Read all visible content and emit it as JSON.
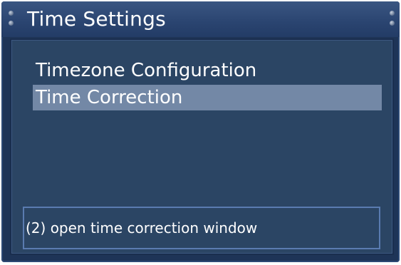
{
  "window": {
    "title": "Time Settings"
  },
  "menu": {
    "items": [
      {
        "label": "Timezone Configuration",
        "selected": false
      },
      {
        "label": "Time Correction",
        "selected": true
      }
    ]
  },
  "status": {
    "text": "(2) open time correction window"
  },
  "colors": {
    "background": "#1e3457",
    "panel": "#2b4564",
    "selection": "#7388a6",
    "status_border": "#5a7bb0",
    "text": "#ffffff"
  }
}
